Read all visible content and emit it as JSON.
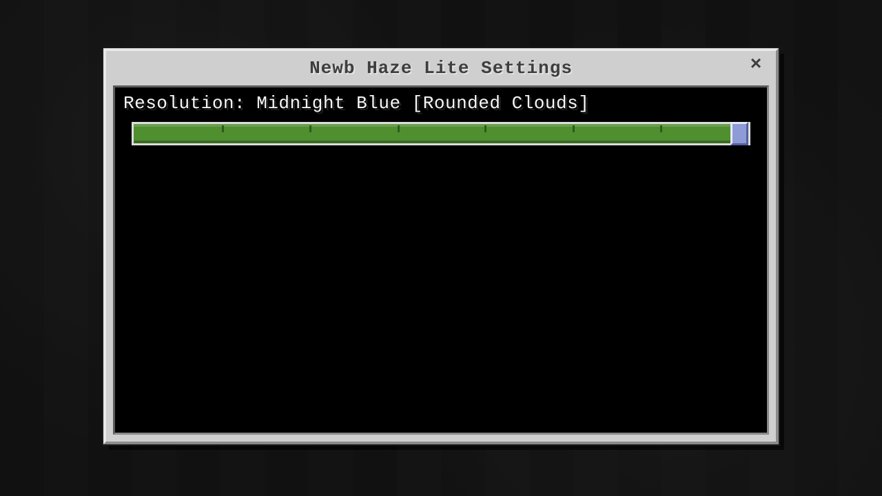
{
  "window": {
    "title": "Newb Haze Lite Settings",
    "close_button": "×"
  },
  "option": {
    "label_prefix": "Resolution:",
    "value_name": "Midnight Blue",
    "value_suffix": "[Rounded Clouds]",
    "full_label": "Resolution: Midnight Blue [Rounded Clouds]"
  },
  "slider": {
    "min": 0,
    "max": 7,
    "value": 7,
    "fill_percent": 100,
    "thumb_percent": 100,
    "ticks_percent": [
      14.3,
      28.6,
      42.9,
      57.1,
      71.4,
      85.7,
      99.0
    ],
    "fill_color": "#4f8f2f",
    "thumb_color": "#8f9bd6"
  }
}
